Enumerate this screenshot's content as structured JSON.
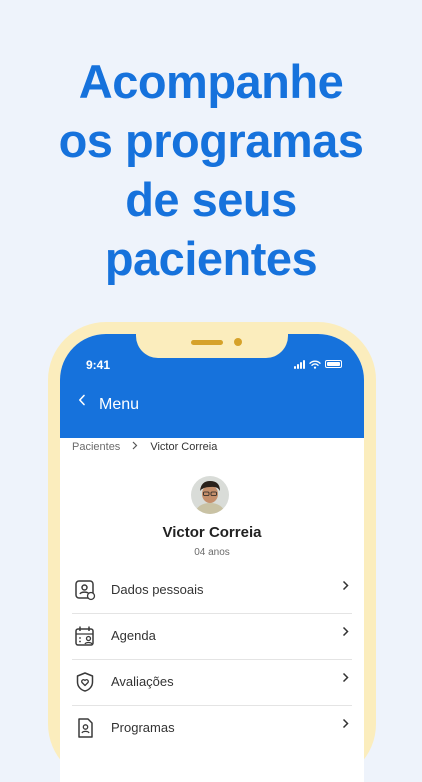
{
  "headline": {
    "lines": [
      "Acompanhe",
      "os programas",
      "de seus",
      "pacientes"
    ]
  },
  "device": {
    "status_time": "9:41",
    "menu_title": "Menu",
    "back_icon": "chevron-left-icon"
  },
  "breadcrumb": {
    "root": "Pacientes",
    "separator_icon": "chevron-right-icon",
    "current": "Victor Correia"
  },
  "patient": {
    "name": "Victor Correia",
    "age": "04 anos"
  },
  "menu_items": [
    {
      "label": "Dados pessoais",
      "icon": "profile-card-icon"
    },
    {
      "label": "Agenda",
      "icon": "calendar-user-icon"
    },
    {
      "label": "Avaliações",
      "icon": "shield-heart-icon"
    },
    {
      "label": "Programas",
      "icon": "document-user-icon"
    }
  ],
  "colors": {
    "accent": "#1672dc",
    "frame": "#fbedbd",
    "background": "#eef3fb"
  }
}
